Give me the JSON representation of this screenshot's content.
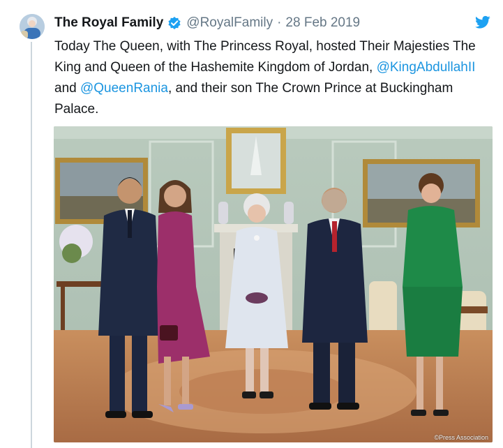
{
  "tweet": {
    "author_name": "The Royal Family",
    "handle": "@RoyalFamily",
    "separator": "·",
    "date": "28 Feb 2019",
    "text": {
      "part1": "Today The Queen, with The Princess Royal, hosted Their Majesties The King and Queen of the Hashemite Kingdom of Jordan, ",
      "mention1": "@KingAbdullahII",
      "part2": " and ",
      "mention2": "@QueenRania",
      "part3": ", and their son The Crown Prince at Buckingham Palace."
    },
    "photo_credit": "©Press Association"
  },
  "icons": {
    "verified": "verified-badge-icon",
    "platform": "twitter-bird-icon"
  },
  "colors": {
    "link": "#1b95e0",
    "verified": "#1da1f2",
    "muted": "#657786",
    "text": "#14171a"
  }
}
